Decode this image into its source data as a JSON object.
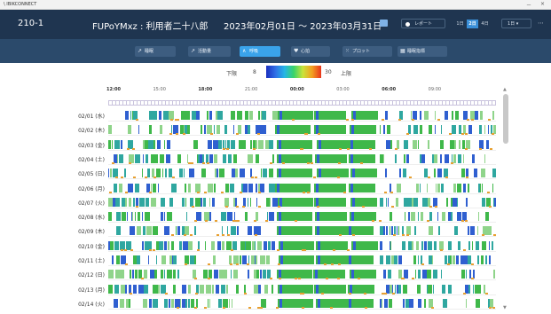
{
  "window": {
    "app_name": "\\ IBIKCONNECT",
    "minimize": "－",
    "close": "×"
  },
  "header": {
    "patient_id": "210-1",
    "user_name": "FUPoYMxz : 利用者二十八郎",
    "date_range": "2023年02月01日 ～ 2023年03月31日",
    "report_button": "レポート",
    "day_toggle": [
      "1日",
      "2日",
      "4日"
    ],
    "day_selected": "2日",
    "period_select": "1日 ▾"
  },
  "toolbar": {
    "items": [
      {
        "label": "睡眠",
        "icon": "↗"
      },
      {
        "label": "活動量",
        "icon": "↗"
      },
      {
        "label": "呼吸",
        "icon": "∧",
        "active": true
      },
      {
        "label": "心拍",
        "icon": "♥"
      },
      {
        "label": "プロット",
        "icon": "⁙"
      },
      {
        "label": "睡眠指標",
        "icon": "▦"
      }
    ]
  },
  "legend": {
    "lower_label": "下限",
    "lower_value": "8",
    "upper_value": "30",
    "upper_label": "上限"
  },
  "time_axis": [
    "12:00",
    "15:00",
    "18:00",
    "21:00",
    "00:00",
    "03:00",
    "06:00",
    "09:00"
  ],
  "bold_ticks": [
    "12:00",
    "18:00",
    "00:00",
    "06:00"
  ],
  "days": [
    "02/01 (水)",
    "02/02 (木)",
    "02/03 (金)",
    "02/04 (土)",
    "02/05 (日)",
    "02/06 (月)",
    "02/07 (火)",
    "02/08 (水)",
    "02/09 (木)",
    "02/10 (金)",
    "02/11 (土)",
    "02/12 (日)",
    "02/13 (月)",
    "02/14 (火)"
  ],
  "colors": {
    "header_bg": "#1f3550",
    "toolbar_bg": "#2b4a6b",
    "accent": "#3aa3ea",
    "sleep_green": "#3fb84a",
    "in_bed_blue": "#2f5fd0",
    "teal": "#2fa7a0",
    "light_green": "#8fd48a",
    "awake_orange": "#e8a030",
    "timeline_rule": "#c9c3dd"
  }
}
